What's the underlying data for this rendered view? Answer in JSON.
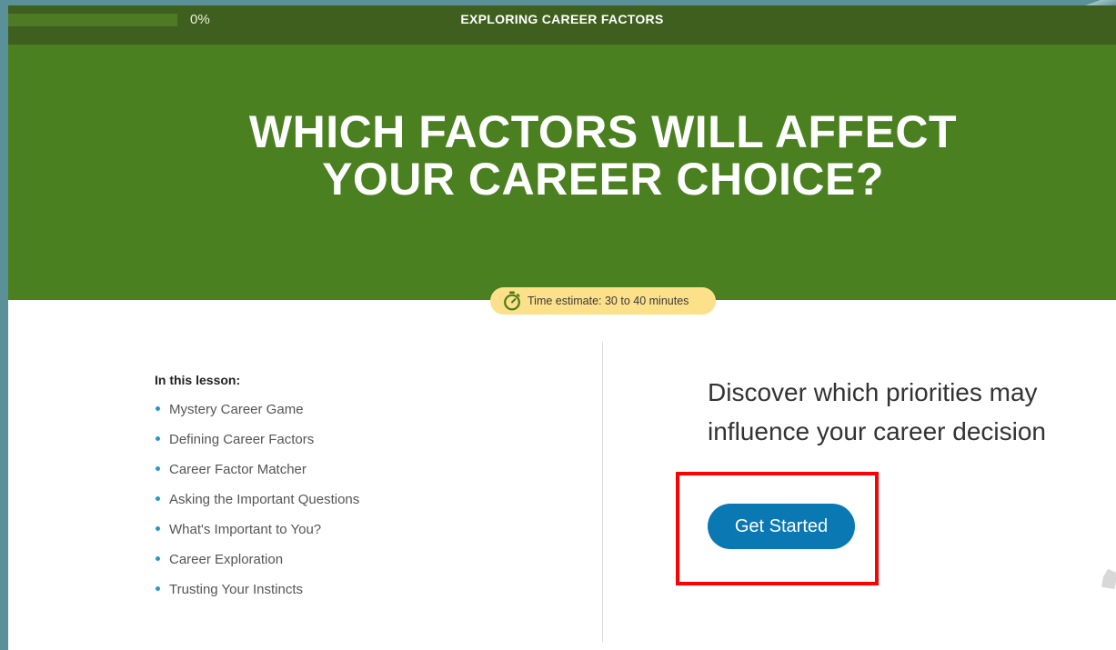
{
  "topbar": {
    "progress_value": 0,
    "progress_text": "0%",
    "title": "EXPLORING CAREER FACTORS"
  },
  "hero": {
    "title_line1": "WHICH FACTORS WILL AFFECT",
    "title_line2": "YOUR CAREER CHOICE?"
  },
  "time_estimate": {
    "icon": "stopwatch-icon",
    "text": "Time estimate: 30 to 40 minutes"
  },
  "lesson": {
    "heading": "In this lesson:",
    "items": [
      "Mystery Career Game",
      "Defining Career Factors",
      "Career Factor Matcher",
      "Asking the Important Questions",
      "What's Important to You?",
      "Career Exploration",
      "Trusting Your Instincts"
    ]
  },
  "description": "Discover which priorities may influence your career decision",
  "cta": {
    "label": "Get Started"
  },
  "colors": {
    "topbar": "#3f5f1e",
    "hero": "#4a801f",
    "pill": "#fde08a",
    "button": "#0a78b3",
    "bullet": "#2a96c6",
    "highlight": "#ff0000"
  }
}
